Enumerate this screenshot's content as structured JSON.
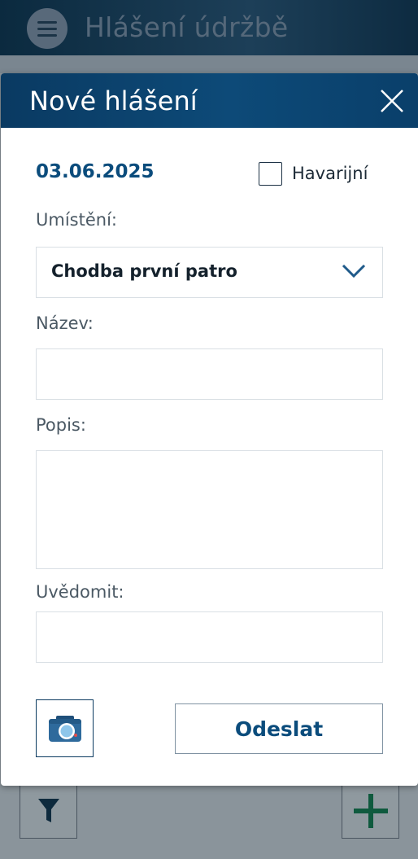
{
  "app": {
    "title": "Hlášení údržbě",
    "menu_icon": "hamburger-icon"
  },
  "toolbar": {
    "filter_icon": "filter-icon",
    "add_icon": "plus-icon"
  },
  "modal": {
    "title": "Nové hlášení",
    "close_icon": "close-icon",
    "date": "03.06.2025",
    "emergency": {
      "label": "Havarijní",
      "checked": false
    },
    "location": {
      "label": "Umístění:",
      "value": "Chodba první patro"
    },
    "name": {
      "label": "Název:",
      "value": ""
    },
    "description": {
      "label": "Popis:",
      "value": ""
    },
    "notify": {
      "label": "Uvědomit:",
      "value": ""
    },
    "camera_icon": "camera-icon",
    "submit_label": "Odeslat"
  },
  "colors": {
    "header_dark": "#0b2a3f",
    "modal_header": "#0d4a78",
    "accent_text": "#0b4c7c",
    "overlay": "#8c959c",
    "add_plus": "#0f5a3e"
  }
}
